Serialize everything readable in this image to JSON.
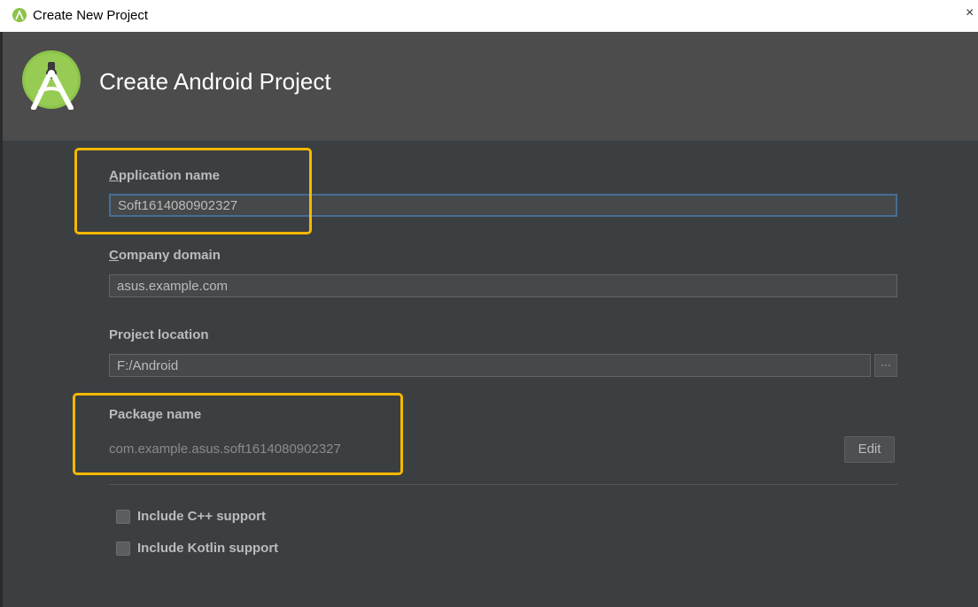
{
  "window": {
    "title": "Create New Project",
    "close_label": "×"
  },
  "header": {
    "heading": "Create Android Project",
    "logo_icon": "android-studio-logo-icon"
  },
  "form": {
    "app_name": {
      "label_underline": "A",
      "label_rest": "pplication name",
      "value": "Soft1614080902327"
    },
    "company_domain": {
      "label_underline": "C",
      "label_rest": "ompany domain",
      "value": "asus.example.com"
    },
    "project_location": {
      "label": "Project location",
      "value": "F:/Android",
      "browse_label": "···"
    },
    "package_name": {
      "label": "Package name",
      "value": "com.example.asus.soft1614080902327",
      "edit_label": "Edit"
    },
    "options": [
      {
        "label": "Include C++ support",
        "checked": false
      },
      {
        "label": "Include Kotlin support",
        "checked": false
      }
    ]
  },
  "colors": {
    "highlight": "#f5b800",
    "background": "#3c3f41",
    "header": "#4c4c4c",
    "android_green": "#8bc34a"
  }
}
